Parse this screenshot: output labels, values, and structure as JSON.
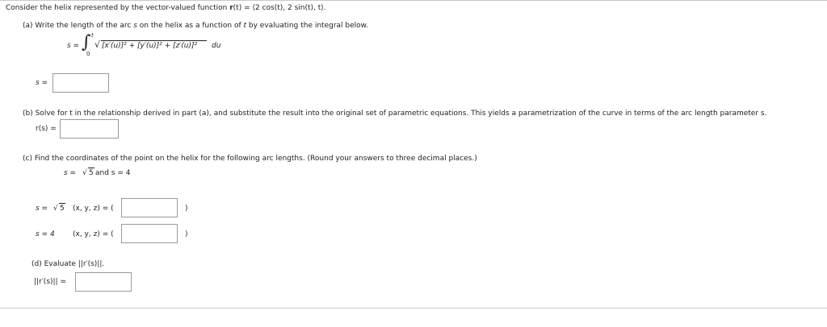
{
  "intro": {
    "lead": "Consider the helix represented by the vector-valued function ",
    "fn_bold": "r",
    "fn_rest": "(t) = ⟨2 cos(t), 2 sin(t), t⟩."
  },
  "part_a": {
    "prompt_pre": "(a) Write the length of the arc ",
    "var_s": "s",
    "prompt_mid": " on the helix as a function of ",
    "var_t": "t",
    "prompt_post": " by evaluating the integral below.",
    "lhs": "s =",
    "upper": "t",
    "lower": "0",
    "integrand": "[x′(u)]² + [y′(u)]² + [z′(u)]²",
    "du": "du",
    "answer_label": "s =",
    "answer_value": ""
  },
  "part_b": {
    "prompt": "(b) Solve for t in the relationship derived in part (a), and substitute the result into the original set of parametric equations. This yields a parametrization of the curve in terms of the arc length parameter s.",
    "answer_label": "r(s) =",
    "answer_value": ""
  },
  "part_c": {
    "prompt": "(c) Find the coordinates of the point on the helix for the following arc lengths. (Round your answers to three decimal places.)",
    "given_pre": "s = ",
    "given_rad": "5",
    "given_post": " and s = 4",
    "row1_pre": "s = ",
    "row1_rad": "5",
    "row1_coords": "(x, y, z) = (",
    "row1_close": ")",
    "row1_value": "",
    "row2_label": "s = 4",
    "row2_coords": "(x, y, z) = (",
    "row2_close": ")",
    "row2_value": ""
  },
  "part_d": {
    "prompt": "(d) Evaluate ||r′(s)||.",
    "answer_label": "||r′(s)|| =",
    "answer_value": ""
  }
}
